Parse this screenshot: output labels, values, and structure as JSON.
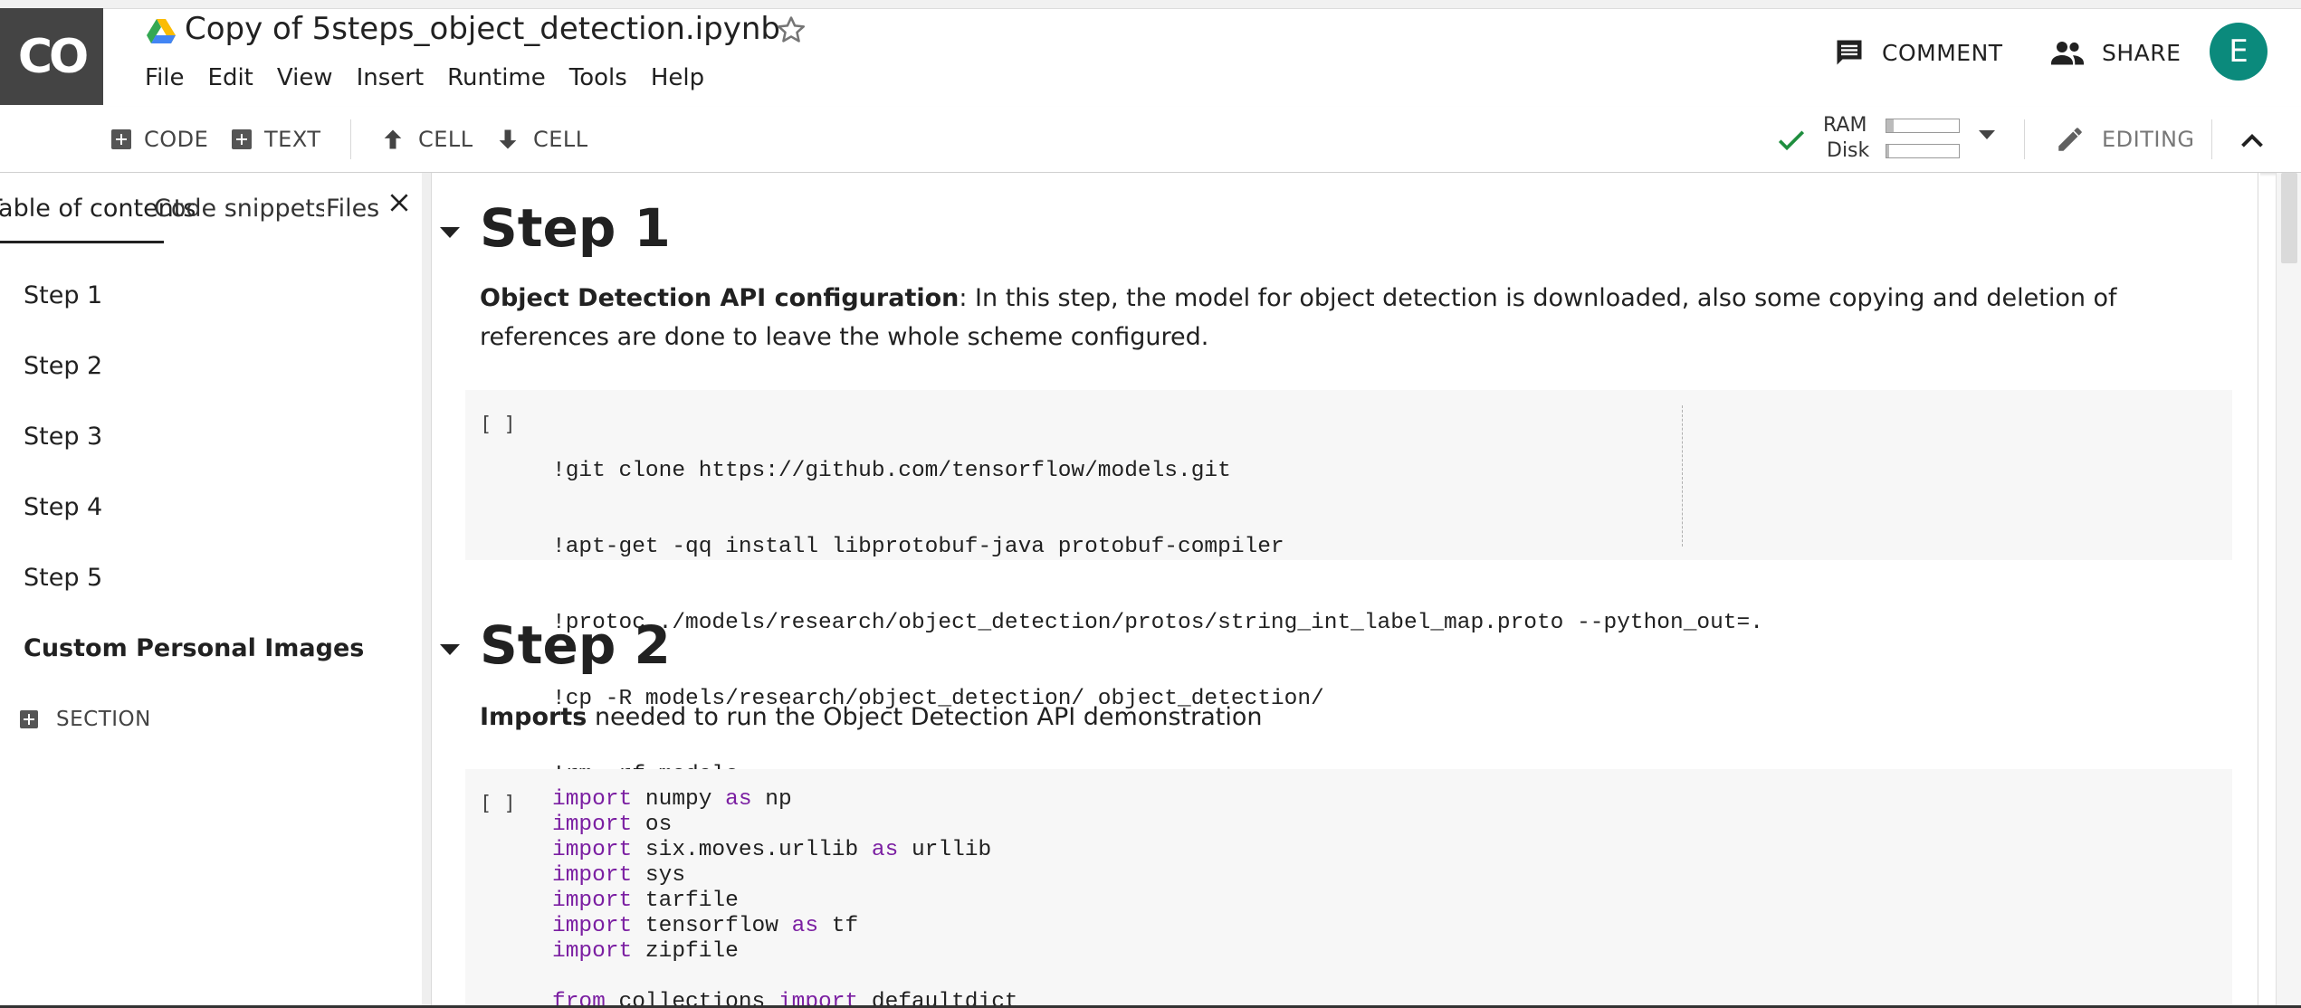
{
  "app": {
    "logo_text": "CO",
    "doc_title": "Copy of 5steps_object_detection.ipynb",
    "menu": [
      "File",
      "Edit",
      "View",
      "Insert",
      "Runtime",
      "Tools",
      "Help"
    ],
    "comment_label": "COMMENT",
    "share_label": "SHARE",
    "avatar_letter": "E",
    "avatar_color": "#0b8a7c"
  },
  "toolbar": {
    "add_code": "CODE",
    "add_text": "TEXT",
    "cell_up": "CELL",
    "cell_down": "CELL",
    "ram_label": "RAM",
    "disk_label": "Disk",
    "editing_label": "EDITING"
  },
  "sidebar": {
    "tabs": [
      "Table of contents",
      "Code snippets",
      "Files"
    ],
    "toc": [
      {
        "label": "Step 1",
        "bold": false
      },
      {
        "label": "Step 2",
        "bold": false
      },
      {
        "label": "Step 3",
        "bold": false
      },
      {
        "label": "Step 4",
        "bold": false
      },
      {
        "label": "Step 5",
        "bold": false
      },
      {
        "label": "Custom Personal Images",
        "bold": true
      }
    ],
    "add_section": "SECTION"
  },
  "notebook": {
    "step1": {
      "heading": "Step 1",
      "text_bold": "Object Detection API configuration",
      "text_rest": ": In this step, the model for object detection is downloaded, also some copying and deletion of references are done to leave the whole scheme configured.",
      "run_indicator": "[ ]",
      "code": [
        "!git clone https://github.com/tensorflow/models.git",
        "!apt-get -qq install libprotobuf-java protobuf-compiler",
        "!protoc ./models/research/object_detection/protos/string_int_label_map.proto --python_out=.",
        "!cp -R models/research/object_detection/ object_detection/",
        "!rm -rf models"
      ]
    },
    "step2": {
      "heading": "Step 2",
      "text_bold": "Imports",
      "text_rest": " needed to run the Object Detection API demonstration",
      "run_indicator": "[ ]",
      "code": [
        [
          {
            "k": "import"
          },
          {
            "t": " numpy "
          },
          {
            "k": "as"
          },
          {
            "t": " np"
          }
        ],
        [
          {
            "k": "import"
          },
          {
            "t": " os"
          }
        ],
        [
          {
            "k": "import"
          },
          {
            "t": " six.moves.urllib "
          },
          {
            "k": "as"
          },
          {
            "t": " urllib"
          }
        ],
        [
          {
            "k": "import"
          },
          {
            "t": " sys"
          }
        ],
        [
          {
            "k": "import"
          },
          {
            "t": " tarfile"
          }
        ],
        [
          {
            "k": "import"
          },
          {
            "t": " tensorflow "
          },
          {
            "k": "as"
          },
          {
            "t": " tf"
          }
        ],
        [
          {
            "k": "import"
          },
          {
            "t": " zipfile"
          }
        ],
        [
          {
            "t": ""
          }
        ],
        [
          {
            "k": "from"
          },
          {
            "t": " collections "
          },
          {
            "k": "import"
          },
          {
            "t": " defaultdict"
          }
        ]
      ]
    }
  }
}
